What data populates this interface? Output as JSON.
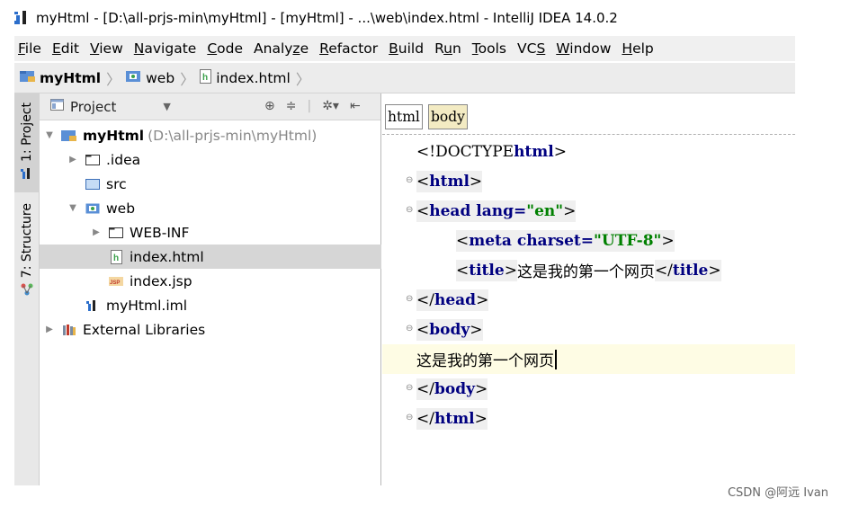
{
  "window": {
    "title": "myHtml - [D:\\all-prjs-min\\myHtml] - [myHtml] - ...\\web\\index.html - IntelliJ IDEA 14.0.2"
  },
  "menu": [
    {
      "pre": "",
      "ul": "F",
      "post": "ile"
    },
    {
      "pre": "",
      "ul": "E",
      "post": "dit"
    },
    {
      "pre": "",
      "ul": "V",
      "post": "iew"
    },
    {
      "pre": "",
      "ul": "N",
      "post": "avigate"
    },
    {
      "pre": "",
      "ul": "C",
      "post": "ode"
    },
    {
      "pre": "Analy",
      "ul": "z",
      "post": "e"
    },
    {
      "pre": "",
      "ul": "R",
      "post": "efactor"
    },
    {
      "pre": "",
      "ul": "B",
      "post": "uild"
    },
    {
      "pre": "R",
      "ul": "u",
      "post": "n"
    },
    {
      "pre": "",
      "ul": "T",
      "post": "ools"
    },
    {
      "pre": "VC",
      "ul": "S",
      "post": ""
    },
    {
      "pre": "",
      "ul": "W",
      "post": "indow"
    },
    {
      "pre": "",
      "ul": "H",
      "post": "elp"
    }
  ],
  "breadcrumb": [
    "myHtml",
    "web",
    "index.html"
  ],
  "sidebar": {
    "project_tab": "1: Project",
    "structure_tab": "7: Structure"
  },
  "project_panel": {
    "view_label": "Project",
    "root": {
      "name": "myHtml",
      "path": "(D:\\all-prjs-min\\myHtml)"
    },
    "items": [
      ".idea",
      "src",
      "web",
      "WEB-INF",
      "index.html",
      "index.jsp",
      "myHtml.iml",
      "External Libraries"
    ]
  },
  "editor": {
    "tag_path": [
      "html",
      "body"
    ],
    "lines": {
      "l1_doctype": "<!DOCTYPE ",
      "l1_html": "html",
      "l1_close": ">",
      "lt": "<",
      "gt": ">",
      "lt_slash": "</",
      "html": "html",
      "head": "head",
      "lang_attr": " lang=",
      "lang_val": "\"en\"",
      "meta": "meta",
      "charset_attr": " charset=",
      "charset_val": "\"UTF-8\"",
      "title_tag": "title",
      "title_text": "这是我的第一个网页",
      "body": "body",
      "body_text": "这是我的第一个网页"
    }
  },
  "watermark": "CSDN @阿远 Ivan",
  "colors": {
    "keyword": "#000080",
    "string": "#008000",
    "caret_line": "#fefce4",
    "selected_row": "#d6d6d6"
  }
}
